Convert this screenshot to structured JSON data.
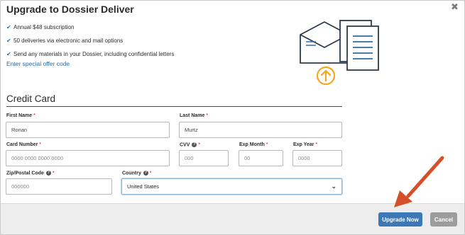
{
  "dialog": {
    "title": "Upgrade to Dossier Deliver",
    "close_label": "✖"
  },
  "benefits": [
    "Annual $48 subscription",
    "50 deliveries via electronic and mail options",
    "Send any materials in your Dossier, including confidential letters"
  ],
  "offer_link": "Enter special offer code",
  "credit_card": {
    "section_title": "Credit Card",
    "required_marker": "*",
    "help_icon_glyph": "?",
    "first_name": {
      "label": "First Name",
      "value": "Ronan"
    },
    "last_name": {
      "label": "Last Name",
      "value": "Murtz"
    },
    "card_number": {
      "label": "Card Number",
      "placeholder": "0000 0000 0000 0000"
    },
    "cvv": {
      "label": "CVV",
      "placeholder": "000"
    },
    "exp_month": {
      "label": "Exp Month",
      "placeholder": "00"
    },
    "exp_year": {
      "label": "Exp Year",
      "placeholder": "0000"
    },
    "zip": {
      "label": "Zip/Postal Code",
      "placeholder": "000000"
    },
    "country": {
      "label": "Country",
      "value": "United States"
    }
  },
  "footer": {
    "upgrade_label": "Upgrade Now",
    "cancel_label": "Cancel"
  },
  "colors": {
    "primary_button": "#3c78b5",
    "cancel_button": "#9c9c9c",
    "link": "#2d6ea6",
    "illustration_accent": "#f5a623",
    "annotation_arrow": "#d4502a",
    "required": "#d0021b"
  },
  "icons": {
    "close": "close-icon",
    "benefit": "checkmark-icon",
    "illustration": "documents-upload-illustration",
    "help": "question-circle-icon",
    "select": "chevron-down-icon",
    "annotation": "annotation-arrow"
  }
}
